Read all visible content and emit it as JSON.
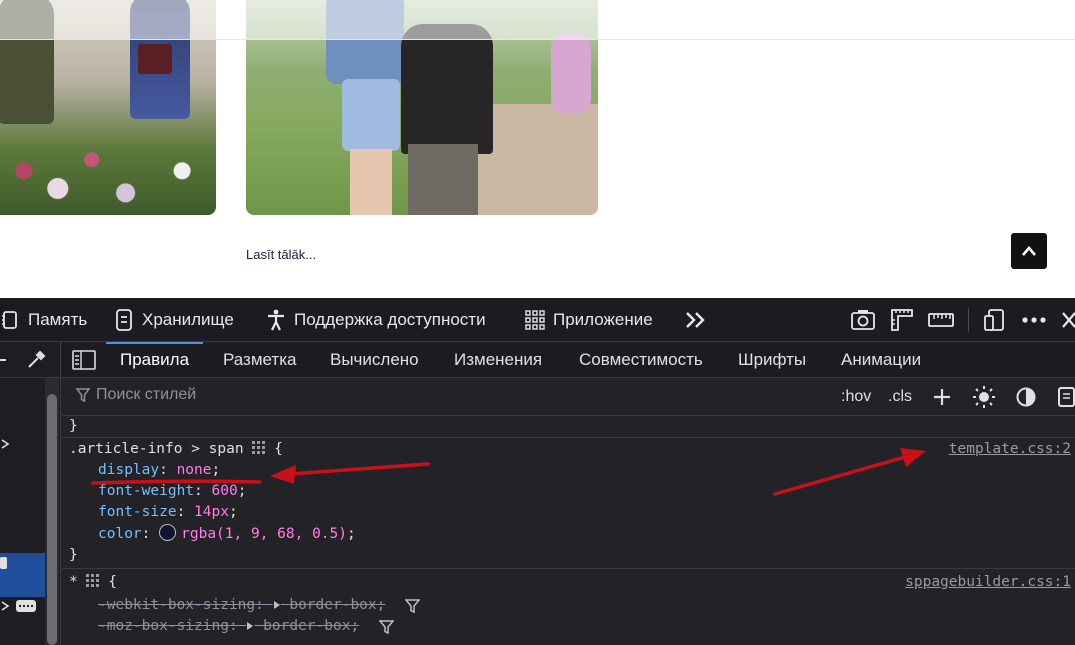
{
  "page": {
    "read_more_label": "Lasīt tālāk..."
  },
  "toolbar": {
    "tabs": [
      {
        "label": "Память",
        "icon": "memory-icon"
      },
      {
        "label": "Хранилище",
        "icon": "storage-icon"
      },
      {
        "label": "Поддержка доступности",
        "icon": "accessibility-icon"
      },
      {
        "label": "Приложение",
        "icon": "application-icon"
      }
    ]
  },
  "subtabs": {
    "items": [
      "Правила",
      "Разметка",
      "Вычислено",
      "Изменения",
      "Совместимость",
      "Шрифты",
      "Анимации"
    ],
    "active": "Правила"
  },
  "filter": {
    "placeholder": "Поиск стилей",
    "hov_label": ":hov",
    "cls_label": ".cls"
  },
  "rules": {
    "prev_close": "}",
    "rule1": {
      "selector": ".article-info > span",
      "open": "{",
      "source": "template.css:2",
      "decls": [
        {
          "prop": "display",
          "value": "none"
        },
        {
          "prop": "font-weight",
          "value": "600"
        },
        {
          "prop": "font-size",
          "value": "14px"
        },
        {
          "prop": "color",
          "value": "rgba(1, 9, 68, 0.5)"
        }
      ],
      "close": "}"
    },
    "rule2": {
      "selector": "*",
      "open": "{",
      "source": "sppagebuilder.css:1",
      "decls": [
        {
          "prop": "-webkit-box-sizing",
          "value": "border-box"
        },
        {
          "prop": "-moz-box-sizing",
          "value": "border-box"
        }
      ]
    }
  },
  "colors": {
    "annotation_red": "#c8101a",
    "active_tab_blue": "#4a8fe8",
    "property_blue": "#75bfff",
    "value_pink": "#ff7de9",
    "selected_row": "#1f4f9b"
  }
}
